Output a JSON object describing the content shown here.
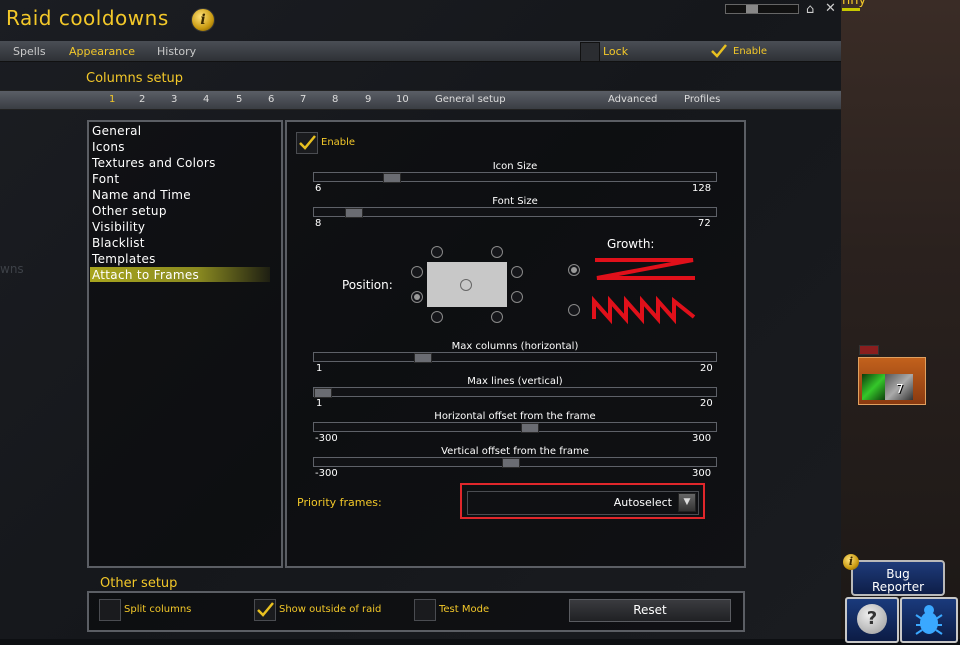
{
  "window": {
    "title": "Raid cooldowns",
    "top_text": "nny"
  },
  "tabs": [
    {
      "label": "Spells"
    },
    {
      "label": "Appearance"
    },
    {
      "label": "History"
    }
  ],
  "lock_label": "Lock",
  "enable_label": "Enable",
  "columns_setup": {
    "title": "Columns setup",
    "numbers": [
      "1",
      "2",
      "3",
      "4",
      "5",
      "6",
      "7",
      "8",
      "9",
      "10"
    ],
    "general_setup": "General setup",
    "advanced": "Advanced",
    "profiles": "Profiles"
  },
  "menu": {
    "items": [
      "General",
      "Icons",
      "Textures and Colors",
      "Font",
      "Name and Time",
      "Other setup",
      "Visibility",
      "Blacklist",
      "Templates",
      "Attach to Frames"
    ],
    "selected": "Attach to Frames"
  },
  "content": {
    "enable_label": "Enable",
    "icon_size": {
      "title": "Icon Size",
      "min": "6",
      "max": "128",
      "value": 0.18
    },
    "font_size": {
      "title": "Font Size",
      "min": "8",
      "max": "72",
      "value": 0.08
    },
    "position_label": "Position:",
    "growth_label": "Growth:",
    "max_columns": {
      "title": "Max columns (horizontal)",
      "min": "1",
      "max": "20",
      "value": 0.26
    },
    "max_lines": {
      "title": "Max lines (vertical)",
      "min": "1",
      "max": "20",
      "value": 0.0
    },
    "h_offset": {
      "title": "Horizontal offset from the frame",
      "min": "-300",
      "max": "300",
      "value": 0.54
    },
    "v_offset": {
      "title": "Vertical offset from the frame",
      "min": "-300",
      "max": "300",
      "value": 0.49
    },
    "priority_label": "Priority frames:",
    "priority_value": "Autoselect"
  },
  "other_setup": {
    "title": "Other setup",
    "split_columns": "Split columns",
    "show_outside_raid": "Show outside of raid",
    "test_mode": "Test Mode",
    "reset": "Reset"
  },
  "bug_reporter": {
    "line1": "Bug",
    "line2": "Reporter"
  },
  "buff_count": "7",
  "colors": {
    "gold": "#f3c829",
    "highlight_red": "#e0272b",
    "growth_red": "#e0101a"
  }
}
